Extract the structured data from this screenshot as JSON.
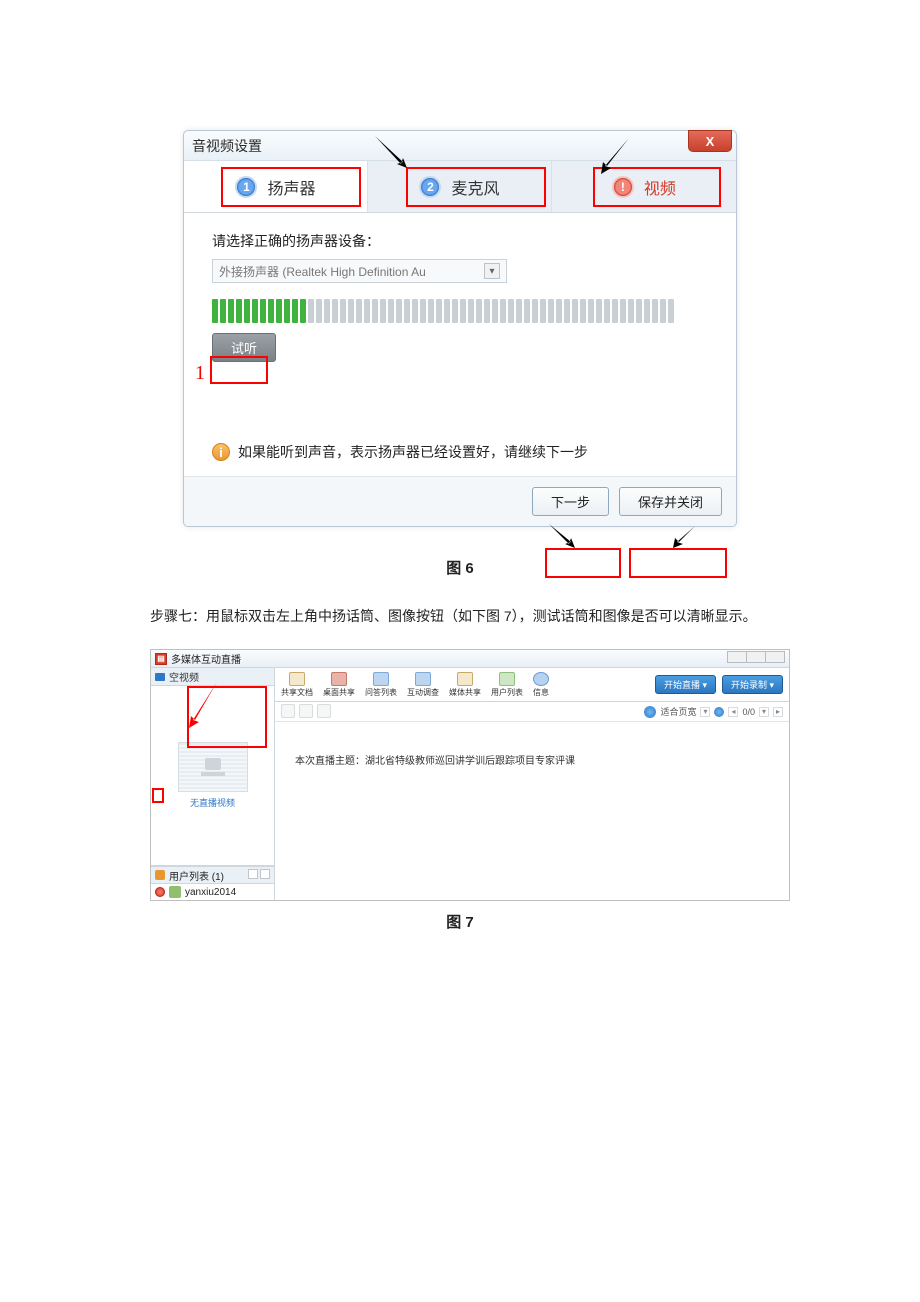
{
  "figure6": {
    "dialog_title": "音视频设置",
    "close_label": "X",
    "tabs": [
      {
        "num": "1",
        "label": "扬声器"
      },
      {
        "num": "2",
        "label": "麦克风"
      },
      {
        "num": "!",
        "label": "视频"
      }
    ],
    "prompt": "请选择正确的扬声器设备：",
    "device_value": "外接扬声器 (Realtek High Definition Au",
    "test_button": "试听",
    "hint": "如果能听到声音，表示扬声器已经设置好，请继续下一步",
    "next_button": "下一步",
    "save_close_button": "保存并关闭",
    "annotation_number": "1",
    "caption": "图 6"
  },
  "step_text": "步骤七：用鼠标双击左上角中扬话筒、图像按钮（如下图 7），测试话筒和图像是否可以清晰显示。",
  "figure7": {
    "app_title": "多媒体互动直播",
    "left": {
      "header": "空视频",
      "no_video": "无直播视频",
      "userlist_title": "用户列表 (1)",
      "user_name": "yanxiu2014"
    },
    "toolbar_items": [
      "共享文档",
      "桌面共享",
      "问答列表",
      "互动调查",
      "媒体共享",
      "用户列表",
      "信息"
    ],
    "buttons": {
      "start": "开始直播 ▾",
      "record": "开始录制 ▾"
    },
    "subbar": {
      "fit": "适合页宽",
      "pager": "0/0"
    },
    "doc_text": "本次直播主题：湖北省特级教师巡回讲学训后跟踪项目专家评课",
    "caption": "图 7"
  }
}
